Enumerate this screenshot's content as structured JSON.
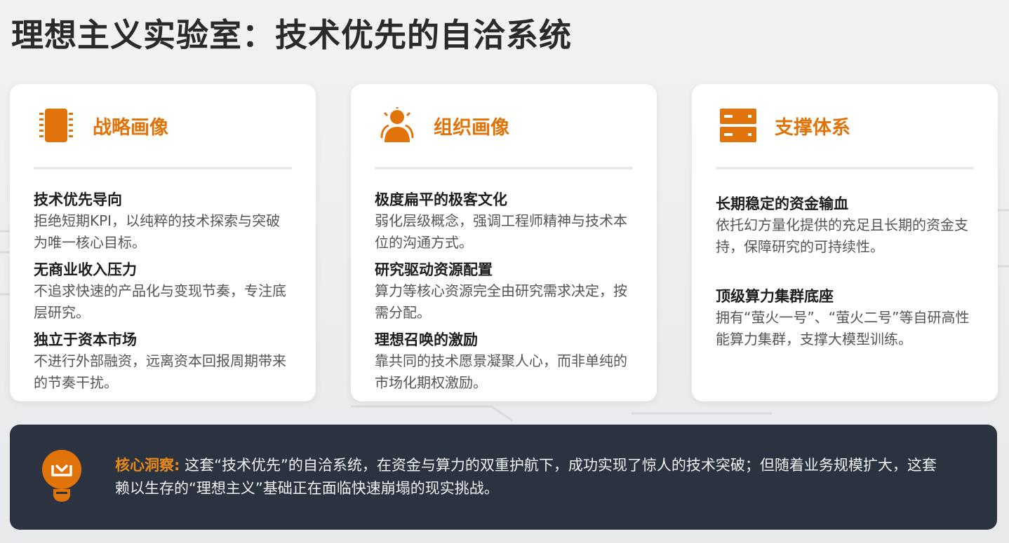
{
  "title": "理想主义实验室：技术优先的自洽系统",
  "cards": [
    {
      "title": "战略画像",
      "icon": "chip-icon",
      "items": [
        {
          "title": "技术优先导向",
          "desc": "拒绝短期KPI，以纯粹的技术探索与突破为唯一核心目标。"
        },
        {
          "title": "无商业收入压力",
          "desc": "不追求快速的产品化与变现节奏，专注底层研究。"
        },
        {
          "title": "独立于资本市场",
          "desc": "不进行外部融资，远离资本回报周期带来的节奏干扰。"
        }
      ]
    },
    {
      "title": "组织画像",
      "icon": "person-icon",
      "items": [
        {
          "title": "极度扁平的极客文化",
          "desc": "弱化层级概念，强调工程师精神与技术本位的沟通方式。"
        },
        {
          "title": "研究驱动资源配置",
          "desc": "算力等核心资源完全由研究需求决定，按需分配。"
        },
        {
          "title": "理想召唤的激励",
          "desc": "靠共同的技术愿景凝聚人心，而非单纯的市场化期权激励。"
        }
      ]
    },
    {
      "title": "支撑体系",
      "icon": "server-icon",
      "items": [
        {
          "title": "长期稳定的资金输血",
          "desc": "依托幻方量化提供的充足且长期的资金支持，保障研究的可持续性。"
        },
        {
          "title": "顶级算力集群底座",
          "desc": "拥有“萤火一号”、“萤火二号”等自研高性能算力集群，支撑大模型训练。"
        }
      ]
    }
  ],
  "insight": {
    "label": "核心洞察:",
    "text": " 这套“技术优先”的自洽系统，在资金与算力的双重护航下，成功实现了惊人的技术突破；但随着业务规模扩大，这套赖以生存的“理想主义”基础正在面临快速崩塌的现实挑战。",
    "icon": "lightbulb-icon"
  },
  "colors": {
    "accent": "#e0740b",
    "dark_panel": "#2b3240"
  }
}
